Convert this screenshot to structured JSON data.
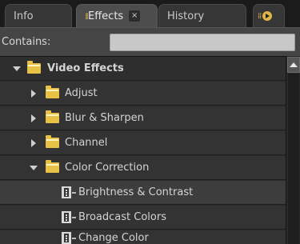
{
  "tabs": {
    "info": "Info",
    "effects": "Effects",
    "effects_close": "×",
    "history": "History"
  },
  "search": {
    "label": "Contains:",
    "value": ""
  },
  "tree": {
    "root": "Video Effects",
    "folders": [
      "Adjust",
      "Blur & Sharpen",
      "Channel",
      "Color Correction"
    ],
    "effects": [
      "Brightness & Contrast",
      "Broadcast Colors",
      "Change Color"
    ]
  },
  "colors": {
    "folder": "#e8c246",
    "accent": "#e3b84a",
    "panel": "#333333"
  }
}
